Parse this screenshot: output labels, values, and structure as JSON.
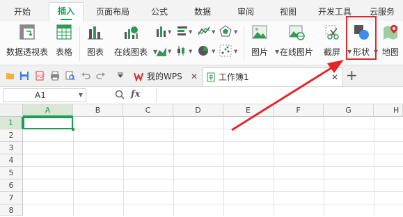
{
  "ribbon_tabs": [
    {
      "label": "开始"
    },
    {
      "label": "插入"
    },
    {
      "label": "页面布局"
    },
    {
      "label": "公式"
    },
    {
      "label": "数据"
    },
    {
      "label": "审阅"
    },
    {
      "label": "视图"
    },
    {
      "label": "开发工具"
    },
    {
      "label": "云服务"
    }
  ],
  "active_tab": "插入",
  "ribbon": {
    "pivot_table": "数据透视表",
    "table": "表格",
    "chart": "图表",
    "online_chart": "在线图表",
    "picture": "图片",
    "online_picture": "在线图片",
    "screenshot": "截屏",
    "shapes": "形状",
    "map": "地图"
  },
  "doc_tabs": {
    "wps_home": "我的WPS",
    "workbook": "工作簿1",
    "add": "+"
  },
  "formula_bar": {
    "name_box": "A1",
    "fx_label": "fx",
    "formula": ""
  },
  "sheet": {
    "columns": [
      "A",
      "B",
      "C",
      "D",
      "E",
      "F",
      "G",
      "H"
    ],
    "rows": [
      "1",
      "2",
      "3",
      "4",
      "5",
      "6",
      "7",
      "8"
    ],
    "selected_cell": "A1"
  },
  "colors": {
    "accent_green": "#1e9c52",
    "highlight_red": "#e2262b"
  }
}
